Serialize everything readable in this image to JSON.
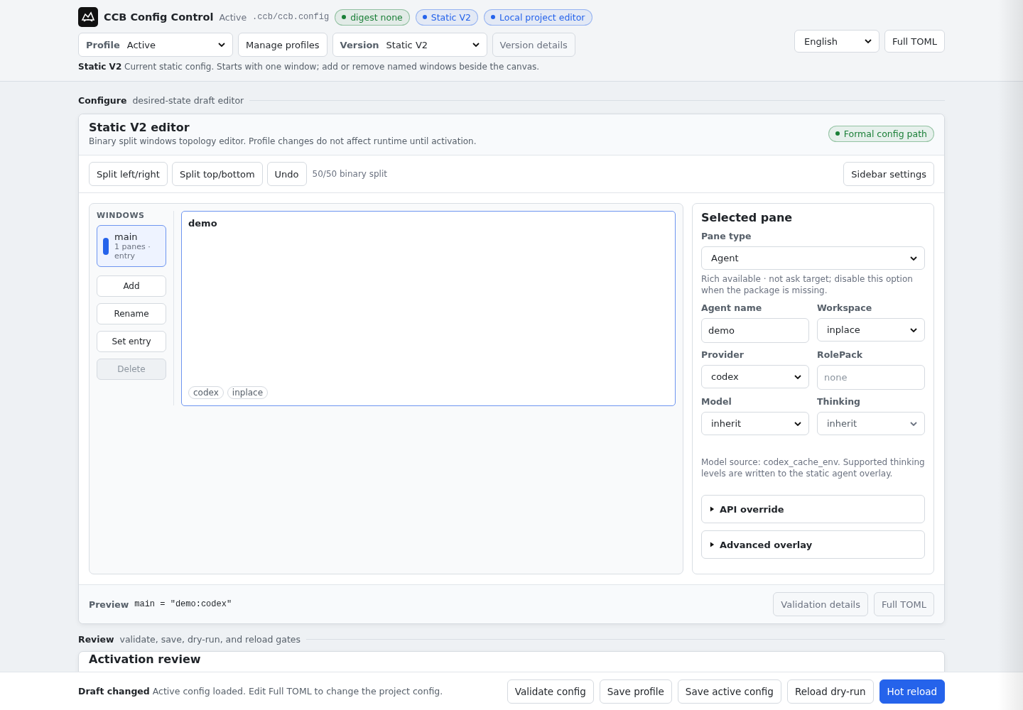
{
  "header": {
    "app_title": "CCB Config Control",
    "status": "Active",
    "path": ".ccb/ccb.config",
    "badges": [
      {
        "label": "digest none",
        "color": "#1a7f37"
      },
      {
        "label": "Static V2",
        "color": "#2563eb"
      },
      {
        "label": "Local project editor",
        "color": "#2563eb"
      }
    ],
    "profile": {
      "label": "Profile",
      "value": "Active"
    },
    "manage_button": {
      "label": "Manage profiles",
      "disabled": false
    },
    "version": {
      "label": "Version",
      "value": "Static V2"
    },
    "version_button": {
      "label": "Version details",
      "disabled": true
    },
    "language": "English",
    "full_toml_button": {
      "label": "Full TOML",
      "disabled": false
    },
    "note": {
      "title": "Static V2",
      "text": "Current static config. Starts with one window; add or remove named windows beside the canvas."
    }
  },
  "configure_section": {
    "title": "Configure",
    "subtitle": "desired-state draft editor"
  },
  "editor": {
    "title": "Static V2 editor",
    "subtitle": "Binary split windows topology editor. Profile changes do not affect runtime until activation.",
    "badge": {
      "label": "Formal config path",
      "color": "#1a7f37"
    },
    "toolbar": {
      "buttons": [
        {
          "label": "Split left/right",
          "disabled": false
        },
        {
          "label": "Split top/bottom",
          "disabled": false
        },
        {
          "label": "Undo",
          "disabled": false
        }
      ],
      "hint": "50/50 binary split",
      "sidebar_button": "Sidebar settings"
    },
    "windows": {
      "heading": "WINDOWS",
      "items": [
        {
          "name": "main",
          "meta": "1 panes · entry",
          "selected": true
        }
      ],
      "actions": [
        {
          "label": "Add",
          "disabled": false
        },
        {
          "label": "Rename",
          "disabled": false
        },
        {
          "label": "Set entry",
          "disabled": false
        },
        {
          "label": "Delete",
          "disabled": true
        }
      ]
    },
    "canvas": {
      "panes": [
        {
          "title": "demo",
          "selected": true,
          "tags": [
            "codex",
            "inplace"
          ]
        }
      ]
    },
    "selected_pane": {
      "title": "Selected pane",
      "pane_type": {
        "label": "Pane type",
        "value": "Agent"
      },
      "pane_type_hint": "Rich available · not ask target; disable this option when the package is missing.",
      "fields": [
        {
          "label": "Agent name",
          "kind": "input",
          "value": "demo",
          "disabled": false
        },
        {
          "label": "Workspace",
          "kind": "select",
          "value": "inplace",
          "disabled": false
        },
        {
          "label": "Provider",
          "kind": "select",
          "value": "codex",
          "disabled": false
        },
        {
          "label": "RolePack",
          "kind": "input",
          "placeholder": "none",
          "disabled": false
        },
        {
          "label": "Model",
          "kind": "select",
          "value": "inherit",
          "disabled": false
        },
        {
          "label": "Thinking",
          "kind": "select",
          "value": "inherit",
          "disabled": true
        }
      ],
      "model_note": "Model source: codex_cache_env. Supported thinking levels are written to the static agent overlay.",
      "sections": [
        {
          "label": "API override",
          "expanded": false
        },
        {
          "label": "Advanced overlay",
          "expanded": false
        }
      ]
    },
    "preview": {
      "label": "Preview",
      "code": "main = \"demo:codex\"",
      "buttons": [
        {
          "label": "Validation details",
          "disabled": true
        },
        {
          "label": "Full TOML",
          "disabled": true
        }
      ]
    }
  },
  "review_section": {
    "title": "Review",
    "subtitle": "validate, save, dry-run, and reload gates"
  },
  "activation_card": {
    "title": "Activation review"
  },
  "footer": {
    "status_title": "Draft changed",
    "status_text": "Active config loaded. Edit Full TOML to change the project config.",
    "buttons": [
      {
        "label": "Validate config",
        "primary": false
      },
      {
        "label": "Save profile",
        "primary": false
      },
      {
        "label": "Save active config",
        "primary": false
      },
      {
        "label": "Reload dry-run",
        "primary": false
      },
      {
        "label": "Hot reload",
        "primary": true
      }
    ]
  }
}
